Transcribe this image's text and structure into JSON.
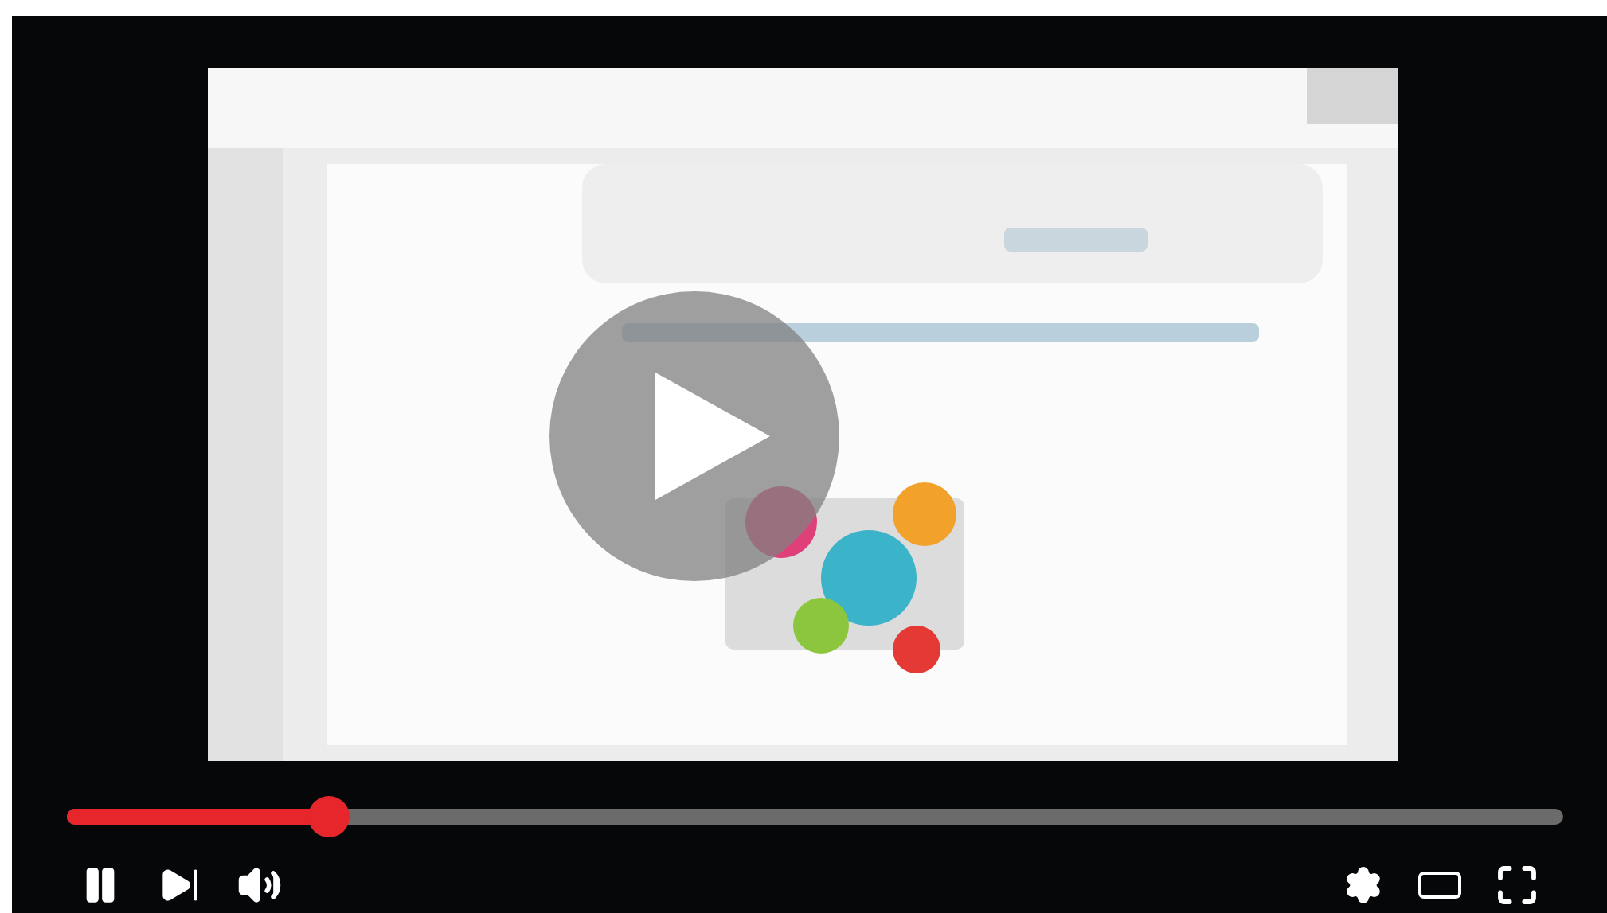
{
  "player": {
    "playing": true,
    "progress": {
      "level": 0.175
    }
  }
}
